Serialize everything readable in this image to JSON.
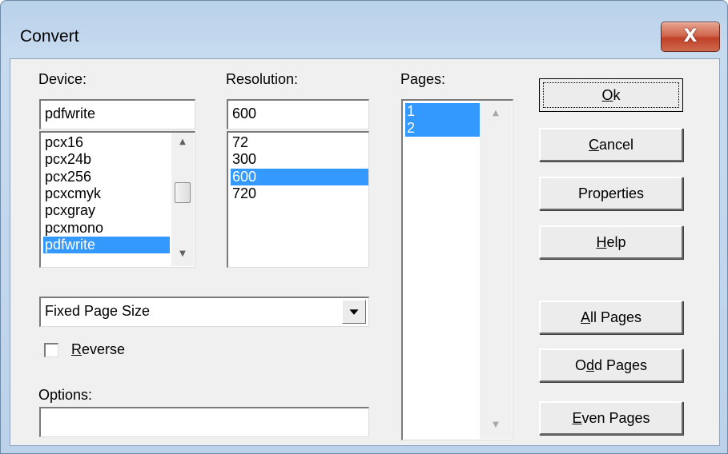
{
  "window": {
    "title": "Convert",
    "close_glyph": "X"
  },
  "device": {
    "label": "Device:",
    "value": "pdfwrite",
    "items": [
      "pcx16",
      "pcx24b",
      "pcx256",
      "pcxcmyk",
      "pcxgray",
      "pcxmono",
      "pdfwrite"
    ],
    "selected": "pdfwrite"
  },
  "resolution": {
    "label": "Resolution:",
    "value": "600",
    "items": [
      "72",
      "300",
      "600",
      "720"
    ],
    "selected": "600"
  },
  "pages": {
    "label": "Pages:",
    "items": [
      "1",
      "2"
    ],
    "selected": [
      "1",
      "2"
    ]
  },
  "page_size": {
    "value": "Fixed Page Size"
  },
  "reverse": {
    "label": "Reverse",
    "mnemonic": "R",
    "checked": false
  },
  "options": {
    "label": "Options:",
    "value": ""
  },
  "buttons": {
    "ok": {
      "label": "Ok",
      "mnemonic": "O"
    },
    "cancel": {
      "label": "Cancel",
      "mnemonic": "C"
    },
    "properties": {
      "label": "Properties"
    },
    "help": {
      "label": "Help",
      "mnemonic": "H"
    },
    "all_pages": {
      "label": "All Pages",
      "mnemonic": "A"
    },
    "odd_pages": {
      "label": "Odd Pages",
      "mnemonic": "d"
    },
    "even_pages": {
      "label": "Even Pages",
      "mnemonic": "E"
    }
  },
  "icons": {
    "scroll_up": "▲",
    "scroll_down": "▼",
    "dropdown": "chevron-down-icon"
  },
  "colors": {
    "selection": "#3399ff",
    "close_button": "#c94a31",
    "title_bar": "#bcd2ea"
  }
}
